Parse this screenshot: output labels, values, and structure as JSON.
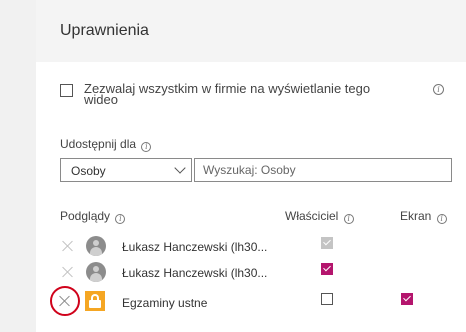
{
  "panel": {
    "title": "Uprawnienia"
  },
  "allow_all": {
    "label": "Zezwalaj wszystkim w firmie na wyświetlanie tego wideo",
    "checked": false,
    "info_icon": "info-icon"
  },
  "share": {
    "label": "Udostępnij dla",
    "info_icon": "info-icon",
    "select_value": "Osoby",
    "search_placeholder": "Wyszukaj: Osoby"
  },
  "columns": {
    "viewers": "Podglądy",
    "owner": "Właściciel",
    "screen": "Ekran"
  },
  "rows": [
    {
      "icon": "user-avatar-icon",
      "name": "Łukasz Hanczewski (lh30...",
      "owner": "checked-disabled",
      "screen": "none"
    },
    {
      "icon": "user-avatar-icon",
      "name": "Łukasz Hanczewski (lh30...",
      "owner": "checked",
      "screen": "none"
    },
    {
      "icon": "lock-group-icon",
      "name": "Egzaminy ustne",
      "owner": "unchecked",
      "screen": "checked"
    }
  ],
  "colors": {
    "accent_checkbox": "#b4156d",
    "lock_icon": "#f5a623",
    "highlight_circle": "#d0021b"
  }
}
